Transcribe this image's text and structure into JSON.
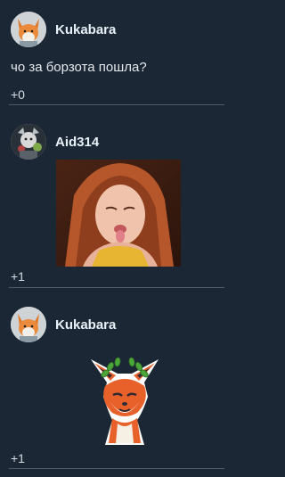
{
  "posts": [
    {
      "username": "Kukabara",
      "text": "чо за борзота пошла?",
      "score": "+0",
      "avatar_icon": "fox-avatar-icon"
    },
    {
      "username": "Aid314",
      "score": "+1",
      "avatar_icon": "character-avatar-icon",
      "media": "woman-tongue-out-gif"
    },
    {
      "username": "Kukabara",
      "score": "+1",
      "avatar_icon": "fox-avatar-icon",
      "media": "fox-laurel-sticker"
    }
  ],
  "colors": {
    "background": "#1b2735",
    "username": "#e8f1f8",
    "divider": "#4a5b6b"
  }
}
